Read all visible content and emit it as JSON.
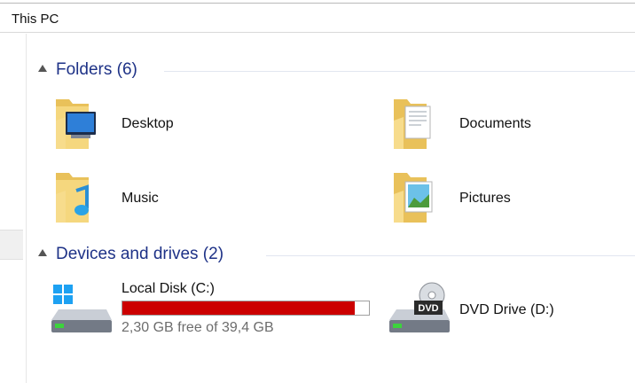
{
  "address": {
    "path": "This PC"
  },
  "groups": {
    "folders": {
      "title": "Folders (6)"
    },
    "devices": {
      "title": "Devices and drives (2)"
    }
  },
  "folders": [
    {
      "label": "Desktop",
      "icon": "desktop-folder-icon"
    },
    {
      "label": "Documents",
      "icon": "documents-folder-icon"
    },
    {
      "label": "Music",
      "icon": "music-folder-icon"
    },
    {
      "label": "Pictures",
      "icon": "pictures-folder-icon"
    }
  ],
  "drives": [
    {
      "label": "Local Disk (C:)",
      "free_text": "2,30 GB free of 39,4 GB",
      "used_fraction": 0.942,
      "bar_color": "#cc0000",
      "icon": "local-disk-icon"
    },
    {
      "label": "DVD Drive (D:)",
      "icon": "dvd-drive-icon",
      "badge": "DVD"
    }
  ],
  "colors": {
    "group_title": "#1e3287",
    "folder": "#f5d77e",
    "accent": "#2aa3e6"
  }
}
